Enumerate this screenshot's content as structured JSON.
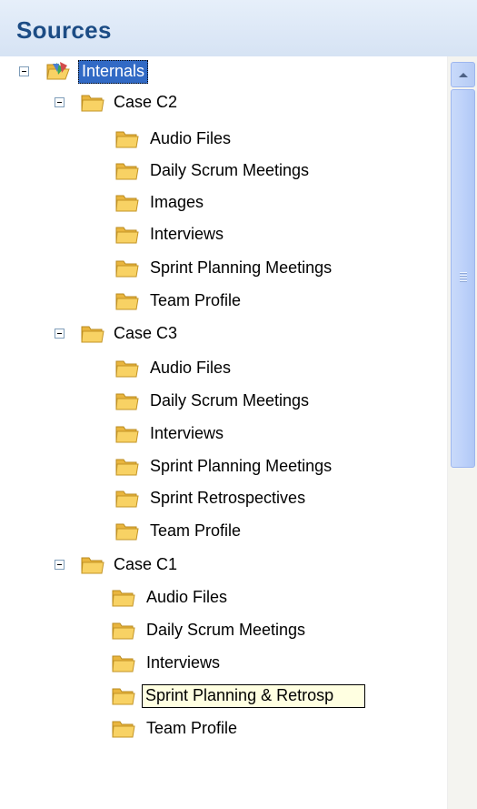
{
  "panel": {
    "title": "Sources"
  },
  "tree": {
    "root": {
      "label": "Internals",
      "selected": true
    },
    "cases": [
      {
        "label": "Case C2",
        "children": [
          "Audio Files",
          "Daily Scrum Meetings",
          "Images",
          "Interviews",
          "Sprint Planning Meetings",
          "Team Profile"
        ]
      },
      {
        "label": "Case C3",
        "children": [
          "Audio Files",
          "Daily Scrum Meetings",
          "Interviews",
          "Sprint Planning Meetings",
          "Sprint Retrospectives",
          "Team Profile"
        ]
      },
      {
        "label": "Case C1",
        "children": [
          "Audio Files",
          "Daily Scrum Meetings",
          "Interviews",
          "Sprint Planning & Retrosp",
          "Team Profile"
        ]
      }
    ],
    "editing_item": {
      "case": 2,
      "child": 3
    }
  },
  "colors": {
    "header_text": "#1c4c85",
    "selection": "#316ac5",
    "folder": "#f8d264"
  },
  "icons": {
    "root": "internals-folder-icon",
    "folder": "folder-icon",
    "expander": "collapse-minus-icon",
    "scroll_up": "arrow-up-icon"
  }
}
